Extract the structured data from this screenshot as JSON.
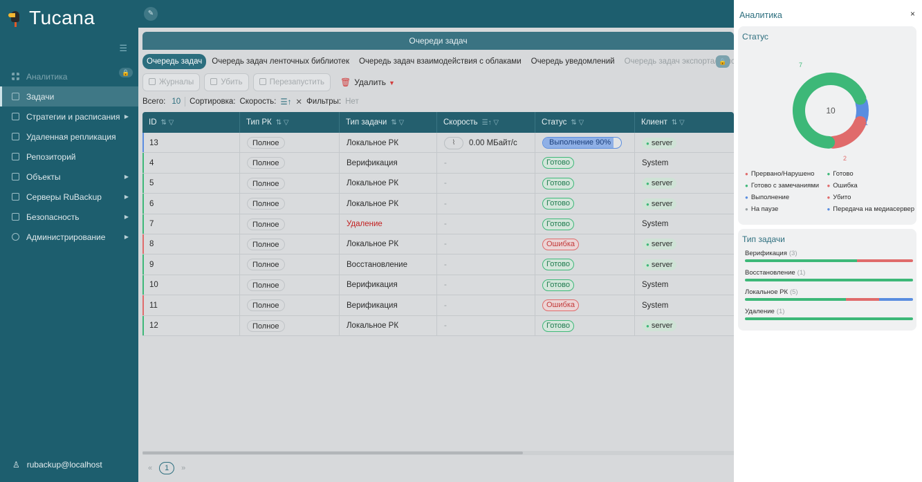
{
  "app": {
    "name": "Tucana"
  },
  "sidebar": {
    "items": [
      {
        "label": "Аналитика",
        "arrow": false
      },
      {
        "label": "Задачи",
        "arrow": false
      },
      {
        "label": "Стратегии и расписания",
        "arrow": true
      },
      {
        "label": "Удаленная репликация",
        "arrow": false
      },
      {
        "label": "Репозиторий",
        "arrow": false
      },
      {
        "label": "Объекты",
        "arrow": true
      },
      {
        "label": "Серверы RuBackup",
        "arrow": true
      },
      {
        "label": "Безопасность",
        "arrow": true
      },
      {
        "label": "Администрирование",
        "arrow": true
      }
    ],
    "user": "rubackup@localhost"
  },
  "main": {
    "queue_title": "Очереди задач",
    "tabs": [
      "Очередь задач",
      "Очередь задач ленточных библиотек",
      "Очередь задач взаимодействия с облаками",
      "Очередь уведомлений",
      "Очередь задач экспорта/импорта"
    ],
    "actions": {
      "logs": "Журналы",
      "kill": "Убить",
      "restart": "Перезапустить",
      "delete": "Удалить"
    },
    "summary": {
      "total_label": "Всего:",
      "total": "10",
      "sort_label": "Сортировка:",
      "sort_value": "Скорость:",
      "sort_symbol": "☰↑",
      "filters_label": "Фильтры:",
      "filters_value": "Нет"
    },
    "table": {
      "columns": [
        "ID",
        "Тип РК",
        "Тип задачи",
        "Скорость",
        "Статус",
        "Клиент"
      ],
      "rows": [
        {
          "id": "13",
          "rk": "Полное",
          "task": "Локальное РК",
          "speed": "0.00 МБайт/с",
          "status": "Выполнение 90%",
          "status_kind": "run",
          "progress": 0.9,
          "client": "server",
          "client_pill": true,
          "task_red": false
        },
        {
          "id": "4",
          "rk": "Полное",
          "task": "Верификация",
          "speed": "-",
          "status": "Готово",
          "status_kind": "done",
          "client": "System",
          "client_pill": false,
          "task_red": false
        },
        {
          "id": "5",
          "rk": "Полное",
          "task": "Локальное РК",
          "speed": "-",
          "status": "Готово",
          "status_kind": "done",
          "client": "server",
          "client_pill": true,
          "task_red": false
        },
        {
          "id": "6",
          "rk": "Полное",
          "task": "Локальное РК",
          "speed": "-",
          "status": "Готово",
          "status_kind": "done",
          "client": "server",
          "client_pill": true,
          "task_red": false
        },
        {
          "id": "7",
          "rk": "Полное",
          "task": "Удаление",
          "speed": "-",
          "status": "Готово",
          "status_kind": "done",
          "client": "System",
          "client_pill": false,
          "task_red": true
        },
        {
          "id": "8",
          "rk": "Полное",
          "task": "Локальное РК",
          "speed": "-",
          "status": "Ошибка",
          "status_kind": "err",
          "client": "server",
          "client_pill": true,
          "task_red": false
        },
        {
          "id": "9",
          "rk": "Полное",
          "task": "Восстановление",
          "speed": "-",
          "status": "Готово",
          "status_kind": "done",
          "client": "server",
          "client_pill": true,
          "task_red": false
        },
        {
          "id": "10",
          "rk": "Полное",
          "task": "Верификация",
          "speed": "-",
          "status": "Готово",
          "status_kind": "done",
          "client": "System",
          "client_pill": false,
          "task_red": false
        },
        {
          "id": "11",
          "rk": "Полное",
          "task": "Верификация",
          "speed": "-",
          "status": "Ошибка",
          "status_kind": "err",
          "client": "System",
          "client_pill": false,
          "task_red": false
        },
        {
          "id": "12",
          "rk": "Полное",
          "task": "Локальное РК",
          "speed": "-",
          "status": "Готово",
          "status_kind": "done",
          "client": "server",
          "client_pill": true,
          "task_red": false
        }
      ]
    },
    "pagination": {
      "prev": "«",
      "page": "1",
      "next": "»"
    }
  },
  "panel": {
    "title": "Аналитика",
    "close": "×",
    "status": {
      "title": "Статус",
      "total": "10",
      "segments": [
        {
          "label": "7",
          "value": 7,
          "color": "#3db878"
        },
        {
          "label": "1",
          "value": 1,
          "color": "#5a8de0"
        },
        {
          "label": "2",
          "value": 2,
          "color": "#e06b6b"
        }
      ],
      "legend": [
        {
          "label": "Прервано/Нарушено",
          "color": "#e06b6b"
        },
        {
          "label": "Готово",
          "color": "#3db878"
        },
        {
          "label": "Готово с замечаниями",
          "color": "#3db878"
        },
        {
          "label": "Ошибка",
          "color": "#e06b6b"
        },
        {
          "label": "Выполнение",
          "color": "#5a8de0"
        },
        {
          "label": "Убито",
          "color": "#e06b6b"
        },
        {
          "label": "На паузе",
          "color": "#9aa1a4"
        },
        {
          "label": "Передача на медиасервер",
          "color": "#5a8de0"
        }
      ]
    },
    "task_types": {
      "title": "Тип задачи",
      "items": [
        {
          "label": "Верификация",
          "count": "(3)",
          "segments": [
            {
              "value": 2,
              "color": "#3db878"
            },
            {
              "value": 1,
              "color": "#e06b6b"
            }
          ]
        },
        {
          "label": "Восстановление",
          "count": "(1)",
          "segments": [
            {
              "value": 1,
              "color": "#3db878"
            }
          ]
        },
        {
          "label": "Локальное РК",
          "count": "(5)",
          "segments": [
            {
              "value": 3,
              "color": "#3db878"
            },
            {
              "value": 1,
              "color": "#e06b6b"
            },
            {
              "value": 1,
              "color": "#5a8de0"
            }
          ]
        },
        {
          "label": "Удаление",
          "count": "(1)",
          "segments": [
            {
              "value": 1,
              "color": "#3db878"
            }
          ]
        }
      ]
    }
  }
}
